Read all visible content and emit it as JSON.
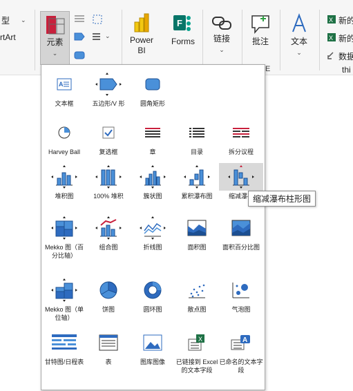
{
  "ribbon": {
    "type_label": "型",
    "smartart_label": "rtArt",
    "elements_label": "元素",
    "powerbi_label": "Power BI",
    "forms_label": "Forms",
    "link_label": "链接",
    "comment_label": "批注",
    "text_label": "文本",
    "new1_label": "新的",
    "new2_label": "新的",
    "data_label": "数据",
    "thi_label": "thi",
    "e_label": "E"
  },
  "gallery": {
    "items": [
      {
        "label": "文本框",
        "icon": "textbox-icon"
      },
      {
        "label": "五边形/V 形",
        "icon": "pentagon-icon"
      },
      {
        "label": "圆角矩形",
        "icon": "rounded-rectangle-icon"
      },
      {
        "label": "Harvey Ball",
        "icon": "harvey-ball-icon"
      },
      {
        "label": "复选框",
        "icon": "checkbox-icon"
      },
      {
        "label": "章",
        "icon": "chapter-icon"
      },
      {
        "label": "目录",
        "icon": "agenda-icon"
      },
      {
        "label": "拆分议程",
        "icon": "split-agenda-icon"
      },
      {
        "label": "堆积图",
        "icon": "stacked-chart-icon"
      },
      {
        "label": "100% 堆积",
        "icon": "stacked-100-chart-icon"
      },
      {
        "label": "簇状图",
        "icon": "clustered-chart-icon"
      },
      {
        "label": "累积瀑布图",
        "icon": "cumulative-waterfall-icon"
      },
      {
        "label": "缩减瀑布",
        "icon": "reducing-waterfall-icon"
      },
      {
        "label": "Mekko 图（百分比轴）",
        "icon": "mekko-percent-icon"
      },
      {
        "label": "组合图",
        "icon": "combo-chart-icon"
      },
      {
        "label": "折线图",
        "icon": "line-chart-icon"
      },
      {
        "label": "面积图",
        "icon": "area-chart-icon"
      },
      {
        "label": "面积百分比图",
        "icon": "area-percent-chart-icon"
      },
      {
        "label": "Mekko 图（单位轴）",
        "icon": "mekko-unit-icon"
      },
      {
        "label": "饼图",
        "icon": "pie-chart-icon"
      },
      {
        "label": "圆环图",
        "icon": "doughnut-chart-icon"
      },
      {
        "label": "散点图",
        "icon": "scatter-chart-icon"
      },
      {
        "label": "气泡图",
        "icon": "bubble-chart-icon"
      },
      {
        "label": "甘特图/日程表",
        "icon": "gantt-icon"
      },
      {
        "label": "表",
        "icon": "table-icon"
      },
      {
        "label": "图库图像",
        "icon": "image-library-icon"
      },
      {
        "label": "已链接到 Excel 的文本字段",
        "icon": "excel-linked-text-icon"
      },
      {
        "label": "已命名的文本字段",
        "icon": "named-text-field-icon"
      }
    ],
    "tooltip": "缩减瀑布柱形图"
  },
  "colors": {
    "accent": "#2e6bbf",
    "mid": "#4a90d9",
    "light": "#a9c6ec",
    "red": "#c8203c"
  }
}
